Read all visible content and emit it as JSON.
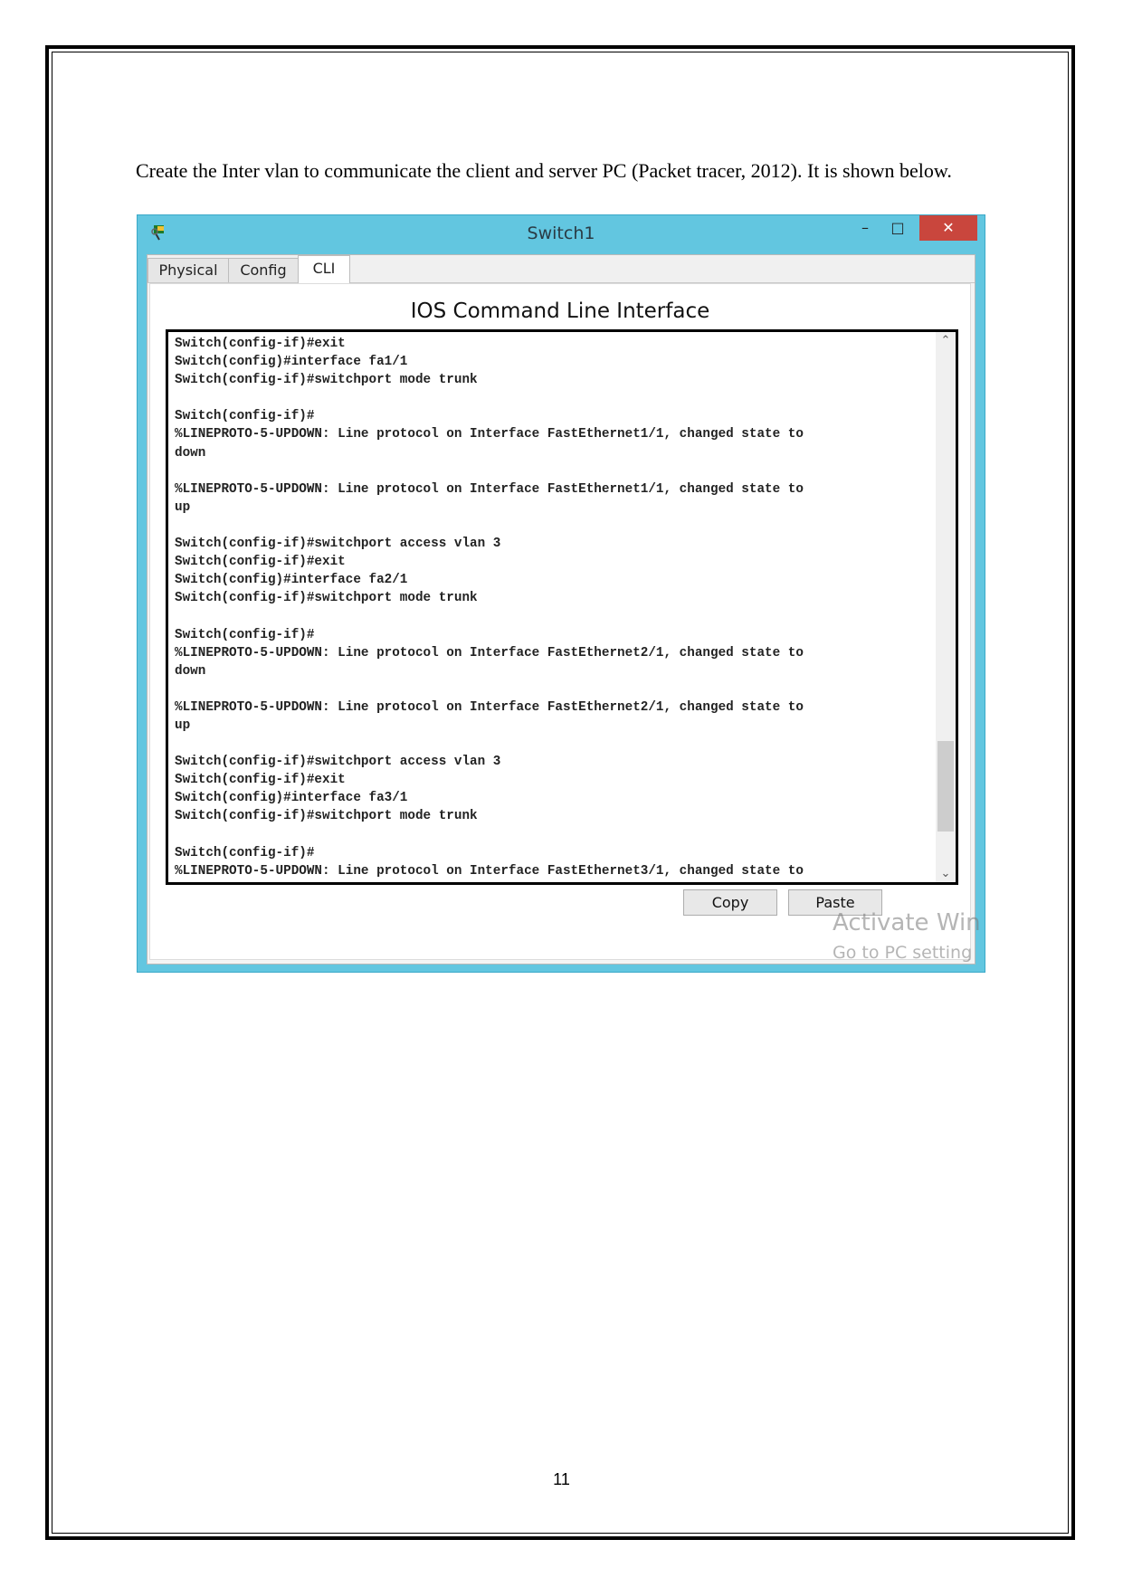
{
  "paragraph": "Create the Inter vlan to communicate the client and server PC (Packet tracer, 2012). It is shown below.",
  "window": {
    "title": "Switch1",
    "controls": {
      "minimize": "–",
      "maximize": "□",
      "close": "✕"
    },
    "tabs": [
      {
        "label": "Physical",
        "active": false
      },
      {
        "label": "Config",
        "active": false
      },
      {
        "label": "CLI",
        "active": true
      }
    ],
    "heading": "IOS Command Line Interface",
    "terminal_lines": [
      "Switch(config-if)#exit",
      "Switch(config)#interface fa1/1",
      "Switch(config-if)#switchport mode trunk",
      "",
      "Switch(config-if)#",
      "%LINEPROTO-5-UPDOWN: Line protocol on Interface FastEthernet1/1, changed state to",
      "down",
      "",
      "%LINEPROTO-5-UPDOWN: Line protocol on Interface FastEthernet1/1, changed state to",
      "up",
      "",
      "Switch(config-if)#switchport access vlan 3",
      "Switch(config-if)#exit",
      "Switch(config)#interface fa2/1",
      "Switch(config-if)#switchport mode trunk",
      "",
      "Switch(config-if)#",
      "%LINEPROTO-5-UPDOWN: Line protocol on Interface FastEthernet2/1, changed state to",
      "down",
      "",
      "%LINEPROTO-5-UPDOWN: Line protocol on Interface FastEthernet2/1, changed state to",
      "up",
      "",
      "Switch(config-if)#switchport access vlan 3",
      "Switch(config-if)#exit",
      "Switch(config)#interface fa3/1",
      "Switch(config-if)#switchport mode trunk",
      "",
      "Switch(config-if)#",
      "%LINEPROTO-5-UPDOWN: Line protocol on Interface FastEthernet3/1, changed state to"
    ],
    "copy_label": "Copy",
    "paste_label": "Paste",
    "watermark_line1": "Activate Win",
    "watermark_line2": "Go to PC setting",
    "accent_color": "#62c6e0"
  },
  "page_number": "11"
}
